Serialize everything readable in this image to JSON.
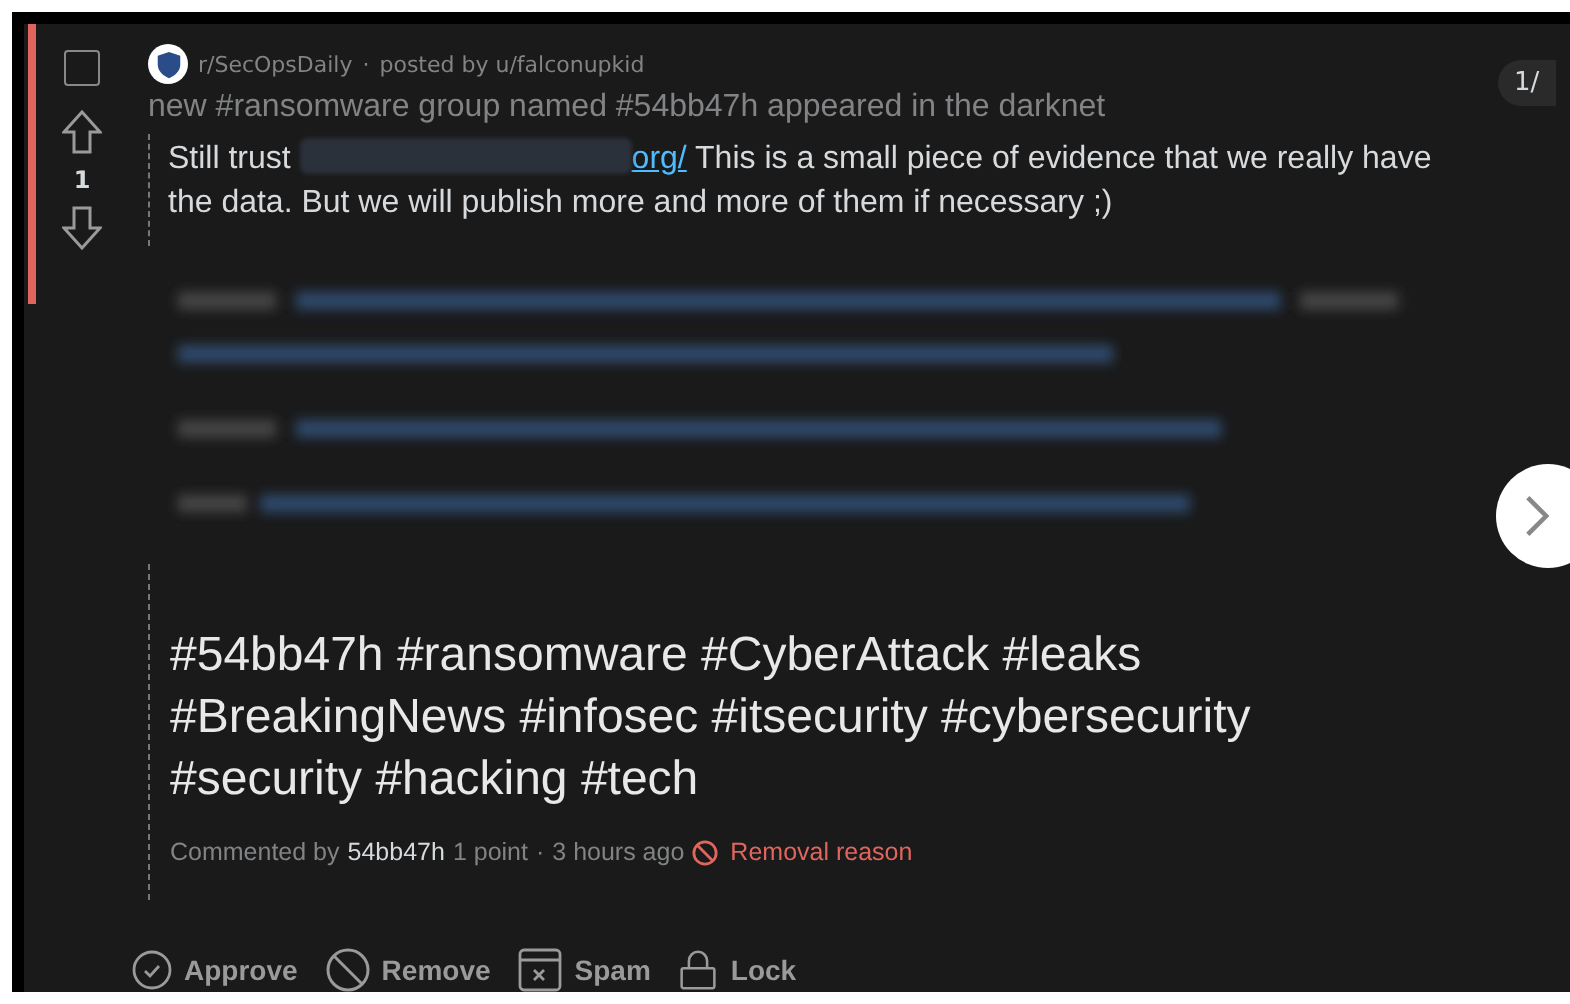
{
  "post": {
    "subreddit": "r/SecOpsDaily",
    "separator": "·",
    "posted_by": "posted by u/falconupkid",
    "title": "new #ransomware group named #54bb47h appeared in the darknet",
    "selected": false,
    "score": "1",
    "removed": true
  },
  "body": {
    "lead": "Still trust",
    "link": "org/",
    "text": "This is a small piece of evidence that we really have the data. But we will publish more and more of them if necessary ;)",
    "redacted": true
  },
  "comment": {
    "hashtags": "#54bb47h #ransomware #CyberAttack #leaks #BreakingNews #infosec #itsecurity #cybersecurity #security #hacking #tech",
    "prefix": "Commented by",
    "author": "54bb47h",
    "points": "1 point",
    "separator": "·",
    "time": "3 hours ago",
    "removal": "Removal reason"
  },
  "actions": [
    {
      "kind": "approve",
      "label": "Approve"
    },
    {
      "kind": "remove",
      "label": "Remove"
    },
    {
      "kind": "spam",
      "label": "Spam"
    },
    {
      "kind": "lock",
      "label": "Lock"
    }
  ],
  "pager": {
    "label": "1/"
  }
}
